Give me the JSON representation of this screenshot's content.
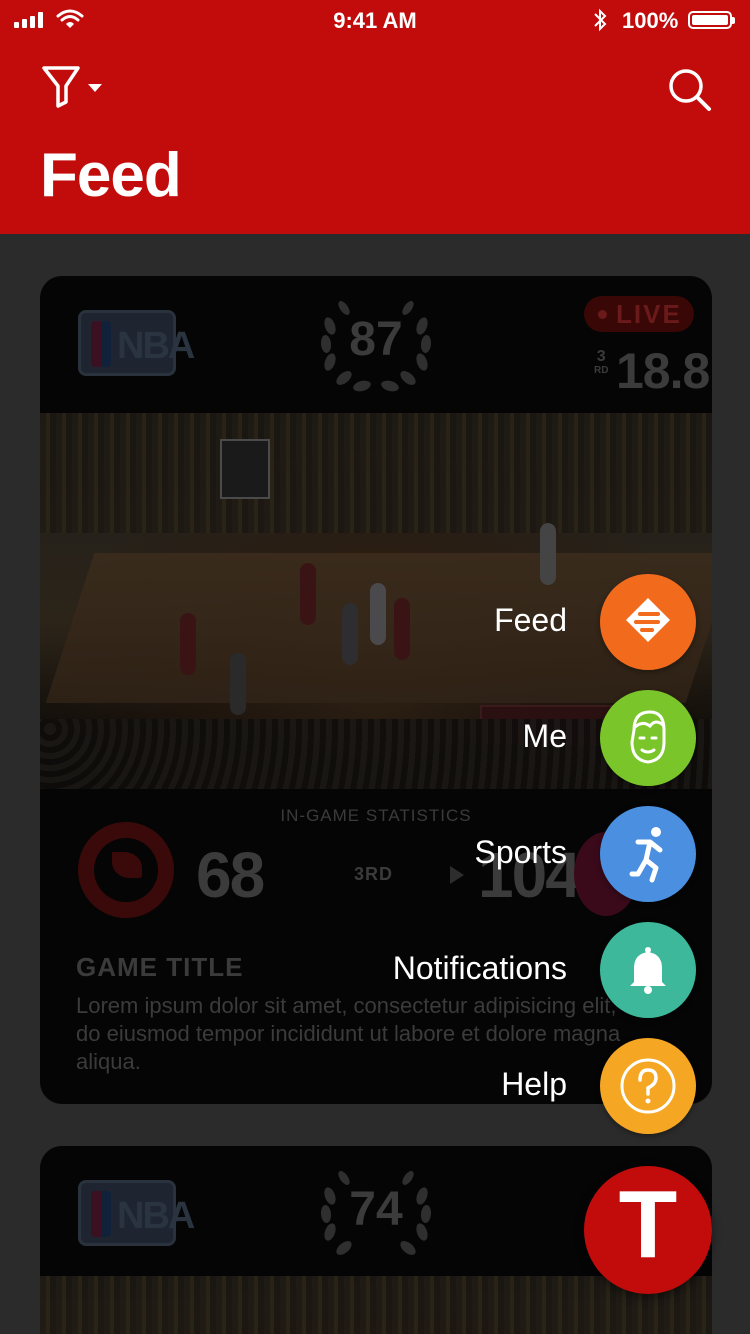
{
  "status_bar": {
    "time": "9:41 AM",
    "battery": "100%"
  },
  "header": {
    "title": "Feed"
  },
  "cards": [
    {
      "league": "NBA",
      "rank": "87",
      "live_label": "LIVE",
      "period_number": "3",
      "period_suffix": "RD",
      "game_clock": "18.8",
      "stats_label": "IN-GAME STATISTICS",
      "home_score": "68",
      "quarter": "3RD",
      "away_score": "104",
      "title": "GAME TITLE",
      "description": "Lorem ipsum dolor sit amet, consectetur adipisicing elit, sed do eiusmod tempor incididunt ut labore et dolore magna aliqua."
    },
    {
      "league": "NBA",
      "rank": "74"
    }
  ],
  "menu": [
    {
      "label": "Feed",
      "icon": "feed-icon",
      "color": "#f26b1d"
    },
    {
      "label": "Me",
      "icon": "face-icon",
      "color": "#7ac62a"
    },
    {
      "label": "Sports",
      "icon": "runner-icon",
      "color": "#4a8fe0"
    },
    {
      "label": "Notifications",
      "icon": "bell-icon",
      "color": "#3db89b"
    },
    {
      "label": "Help",
      "icon": "question-icon",
      "color": "#f5a623"
    }
  ],
  "fab": {
    "label": "T",
    "color": "#c20c0c"
  }
}
